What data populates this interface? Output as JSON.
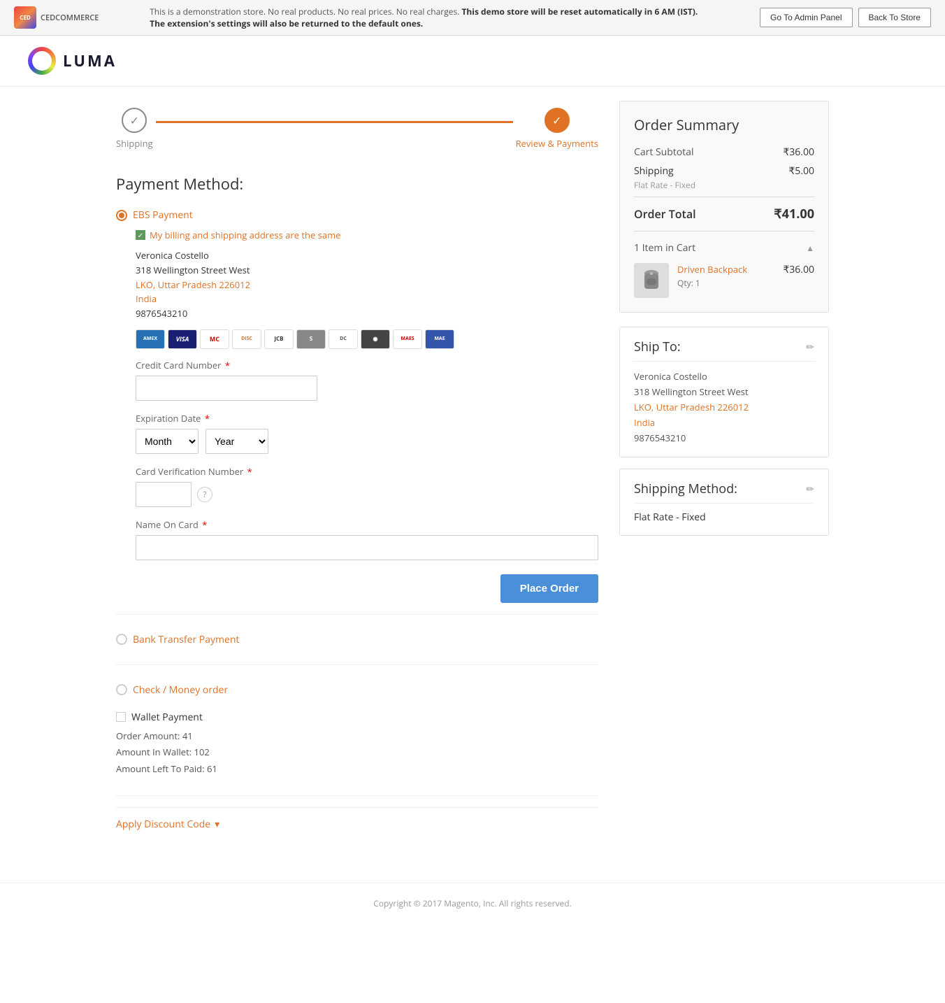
{
  "banner": {
    "text_part1": "This is a demonstration store. No real products. No real prices. No real charges. ",
    "text_bold": "This demo store will be reset automatically in 6 AM (IST). The extension's settings will also be returned to the default ones.",
    "admin_btn": "Go To Admin Panel",
    "store_btn": "Back To Store"
  },
  "logo": {
    "text": "LUMA"
  },
  "progress": {
    "step1_label": "Shipping",
    "step2_label": "Review & Payments"
  },
  "payment": {
    "section_title": "Payment Method:",
    "ebs_label": "EBS Payment",
    "billing_same_label": "My billing and shipping address are the same",
    "address": {
      "name": "Veronica Costello",
      "street": "318 Wellington Street West",
      "city_state": "LKO, Uttar Pradesh 226012",
      "country": "India",
      "phone": "9876543210"
    },
    "credit_card_number_label": "Credit Card Number",
    "expiration_date_label": "Expiration Date",
    "month_placeholder": "Month",
    "year_placeholder": "Year",
    "cvv_label": "Card Verification Number",
    "name_on_card_label": "Name On Card",
    "place_order_btn": "Place Order",
    "bank_transfer_label": "Bank Transfer Payment",
    "check_money_label": "Check / Money order",
    "wallet_label": "Wallet Payment",
    "order_amount_label": "Order Amount:",
    "order_amount_value": "41",
    "amount_in_wallet_label": "Amount In Wallet:",
    "amount_in_wallet_value": "102",
    "amount_left_label": "Amount Left To Paid:",
    "amount_left_value": "61",
    "apply_discount_label": "Apply Discount Code"
  },
  "order_summary": {
    "title": "Order Summary",
    "cart_subtotal_label": "Cart Subtotal",
    "cart_subtotal_value": "₹36.00",
    "shipping_label": "Shipping",
    "shipping_value": "₹5.00",
    "shipping_sub": "Flat Rate - Fixed",
    "order_total_label": "Order Total",
    "order_total_value": "₹41.00",
    "items_in_cart_label": "1 Item in Cart",
    "item_name": "Driven Backpack",
    "item_qty": "Qty: 1",
    "item_price": "₹36.00"
  },
  "ship_to": {
    "title": "Ship To:",
    "name": "Veronica Costello",
    "street": "318 Wellington Street West",
    "city_state": "LKO, Uttar Pradesh 226012",
    "country": "India",
    "phone": "9876543210"
  },
  "shipping_method": {
    "title": "Shipping Method:",
    "value": "Flat Rate - Fixed"
  },
  "footer": {
    "text": "Copyright © 2017 Magento, Inc. All rights reserved."
  }
}
